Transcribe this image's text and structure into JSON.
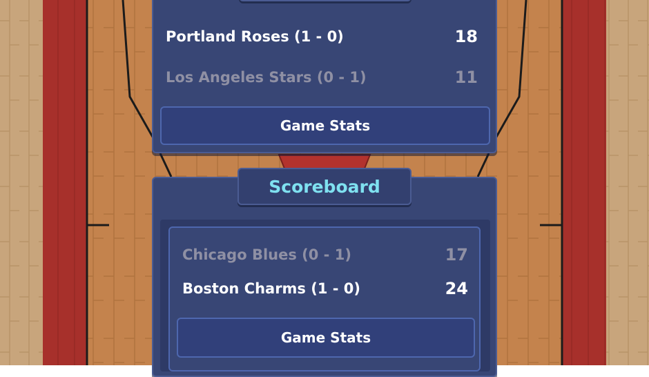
{
  "colors": {
    "panel": "#384675",
    "title": "#7fe1f0",
    "winner_text": "#ffffff",
    "loser_text": "#8f90a4",
    "court_wood": "#c4834d",
    "court_border": "#a7302b"
  },
  "top_game": {
    "team1": {
      "name": "Portland Roses  (1 - 0)",
      "score": "18",
      "status": "winner"
    },
    "team2": {
      "name": "Los Angeles Stars  (0 - 1)",
      "score": "11",
      "status": "loser"
    },
    "stats_button": "Game Stats"
  },
  "bottom_game": {
    "title": "Scoreboard",
    "team1": {
      "name": "Chicago Blues  (0 - 1)",
      "score": "17",
      "status": "loser"
    },
    "team2": {
      "name": "Boston Charms  (1 - 0)",
      "score": "24",
      "status": "winner"
    },
    "stats_button": "Game Stats"
  }
}
